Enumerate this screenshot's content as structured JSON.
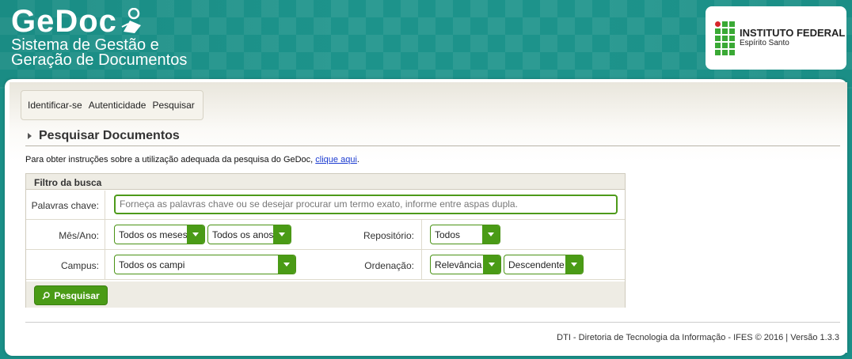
{
  "brand": {
    "name": "GeDoc",
    "subtitle_line1": "Sistema de Gestão e",
    "subtitle_line2": "Geração de Documentos"
  },
  "institution": {
    "line1": "INSTITUTO FEDERAL",
    "line2": "Espírito Santo"
  },
  "menu": {
    "items": [
      "Identificar-se",
      "Autenticidade",
      "Pesquisar"
    ]
  },
  "section": {
    "title": "Pesquisar Documentos"
  },
  "instructions": {
    "text": "Para obter instruções sobre a utilização adequada da pesquisa do GeDoc, ",
    "link": "clique aqui",
    "end": "."
  },
  "filter": {
    "title": "Filtro da busca",
    "keywords_label": "Palavras chave:",
    "keywords_placeholder": "Forneça as palavras chave ou se desejar procurar um termo exato, informe entre aspas dupla.",
    "month_year_label": "Mês/Ano:",
    "month_value": "Todos os meses",
    "year_value": "Todos os anos",
    "repository_label": "Repositório:",
    "repository_value": "Todos",
    "campus_label": "Campus:",
    "campus_value": "Todos os campi",
    "order_label": "Ordenação:",
    "order_by_value": "Relevância",
    "order_dir_value": "Descendente",
    "search_button": "Pesquisar"
  },
  "footer": {
    "text": "DTI - Diretoria de Tecnologia da Informação - IFES © 2016 | Versão 1.3.3"
  },
  "colors": {
    "accent_green": "#4a9b16",
    "banner_teal": "#1d938b",
    "link": "#1a3ad0"
  }
}
